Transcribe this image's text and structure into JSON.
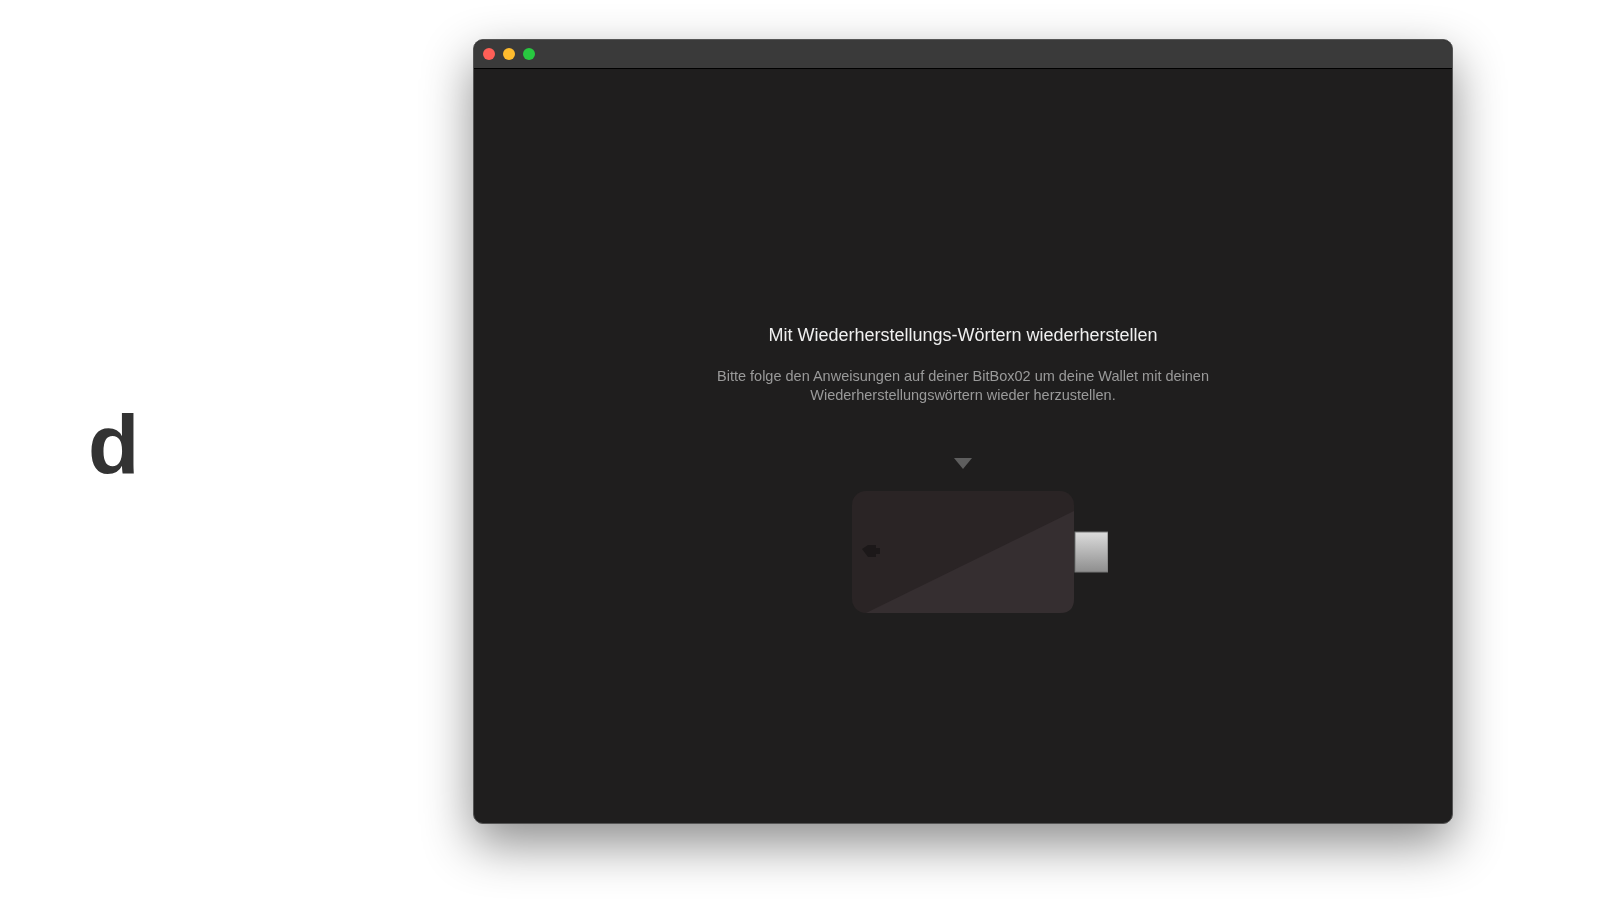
{
  "side_letter": "d",
  "window": {
    "title": "Mit Wiederherstellungs-Wörtern wiederherstellen",
    "description": "Bitte folge den Anweisungen auf deiner BitBox02 um deine Wallet mit deinen Wiederherstellungswörtern wieder herzustellen."
  }
}
